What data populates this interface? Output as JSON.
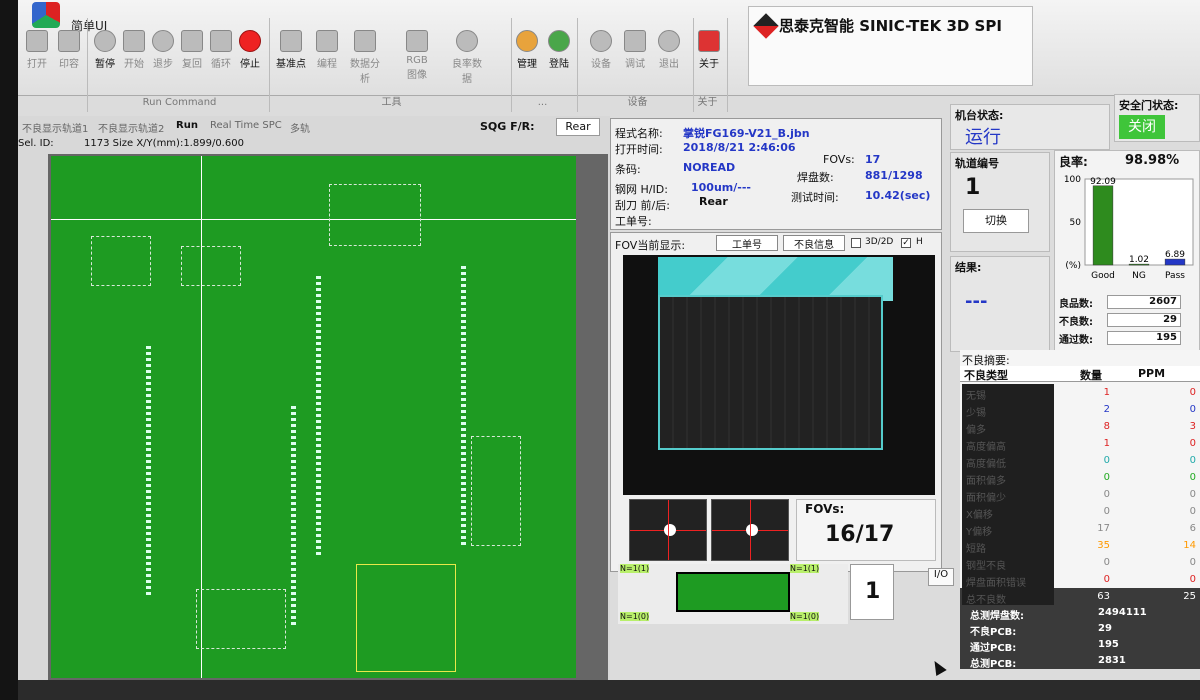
{
  "window": {
    "title": "简单UI"
  },
  "toolbar": {
    "groups": [
      {
        "caption": "",
        "items": [
          "打开",
          "印容"
        ]
      },
      {
        "caption": "Run Command",
        "items": [
          "暂停",
          "开始",
          "退步",
          "复回",
          "循环",
          "停止"
        ]
      },
      {
        "caption": "工具",
        "items": [
          "基准点",
          "编程",
          "数据分析",
          "RGB图像",
          "良率数据"
        ]
      },
      {
        "caption": "...",
        "items": [
          "管理",
          "登陆"
        ]
      },
      {
        "caption": "设备",
        "items": [
          "设备",
          "调试",
          "退出"
        ]
      },
      {
        "caption": "关于",
        "items": [
          "关于"
        ]
      }
    ]
  },
  "brand": {
    "text": "思泰克智能 SINIC-TEK 3D SPI"
  },
  "pcb_view": {
    "tabs": [
      "不良显示轨道1",
      "不良显示轨道2",
      "Run",
      "Real Time SPC",
      "多轨"
    ],
    "sel_id_label": "Sel. ID:",
    "sel_id_value": "1173 Size X/Y(mm):1.899/0.600",
    "sqg_label": "SQG F/R:",
    "sqg_value": "Rear"
  },
  "program_info": {
    "name_label": "程式名称:",
    "name_value": "掌锐FG169-V21_B.jbn",
    "open_time_label": "打开时间:",
    "open_time_value": "2018/8/21 2:46:06",
    "barcode_label": "条码:",
    "barcode_value": "NOREAD",
    "fovs_label": "FOVs:",
    "fovs_value": "17",
    "stencil_label": "钢网 H/ID:",
    "stencil_value": "100um/---",
    "pads_label": "焊盘数:",
    "pads_value": "881/1298",
    "squeegee_label": "刮刀 前/后:",
    "squeegee_value": "Rear",
    "test_time_label": "测试时间:",
    "test_time_value": "10.42(sec)",
    "work_order_label": "工单号:"
  },
  "fov_display": {
    "label": "FOV当前显示:",
    "work_order_btn": "工单号",
    "defect_info_btn": "不良信息",
    "mode_3d2d": "3D/2D",
    "h_label": "H",
    "counter_label": "FOVs:",
    "counter_value": "16/17"
  },
  "machine": {
    "status_label": "机台状态:",
    "status_value": "运行",
    "door_label": "安全门状态:",
    "door_value": "关闭"
  },
  "track": {
    "label": "轨道编号",
    "value": "1",
    "switch_btn": "切换",
    "result_label": "结果:",
    "result_value": "---"
  },
  "yield": {
    "label": "良率:",
    "value": "98.98%"
  },
  "chart_data": {
    "type": "bar",
    "categories": [
      "Good",
      "NG",
      "Pass"
    ],
    "values": [
      92.09,
      1.02,
      6.89
    ],
    "ylim": [
      0,
      100
    ],
    "yticks": [
      "100",
      "50",
      "(%)"
    ],
    "colors": [
      "#2e8b1e",
      "#2e8b1e",
      "#2437c6"
    ]
  },
  "counts": {
    "good_label": "良品数:",
    "good_value": "2607",
    "ng_label": "不良数:",
    "ng_value": "29",
    "pass_label": "通过数:",
    "pass_value": "195"
  },
  "defect_summary": {
    "title": "不良摘要:",
    "headers": [
      "不良类型",
      "数量",
      "PPM"
    ],
    "rows": [
      {
        "type": "无锡",
        "count": "1",
        "ppm": "0"
      },
      {
        "type": "少锡",
        "count": "2",
        "ppm": "0"
      },
      {
        "type": "偏多",
        "count": "8",
        "ppm": "3"
      },
      {
        "type": "高度偏高",
        "count": "1",
        "ppm": "0"
      },
      {
        "type": "高度偏低",
        "count": "0",
        "ppm": "0"
      },
      {
        "type": "面积偏多",
        "count": "0",
        "ppm": "0"
      },
      {
        "type": "面积偏少",
        "count": "0",
        "ppm": "0"
      },
      {
        "type": "X偏移",
        "count": "0",
        "ppm": "0"
      },
      {
        "type": "Y偏移",
        "count": "17",
        "ppm": "6"
      },
      {
        "type": "短路",
        "count": "35",
        "ppm": "14"
      },
      {
        "type": "钢型不良",
        "count": "0",
        "ppm": "0"
      },
      {
        "type": "焊盘面积错误",
        "count": "0",
        "ppm": "0"
      },
      {
        "type": "总不良数",
        "count": "63",
        "ppm": "25"
      }
    ],
    "totals": [
      {
        "label": "总测焊盘数:",
        "value": "2494111"
      },
      {
        "label": "不良PCB:",
        "value": "29"
      },
      {
        "label": "通过PCB:",
        "value": "195"
      },
      {
        "label": "总测PCB:",
        "value": "2831"
      }
    ]
  },
  "track_strip": {
    "n_top_left": "N=1(1)",
    "n_top_right": "N=1(1)",
    "n_bot_left": "N=1(0)",
    "n_bot_right": "N=1(0)",
    "number": "1",
    "io_btn": "I/O"
  }
}
